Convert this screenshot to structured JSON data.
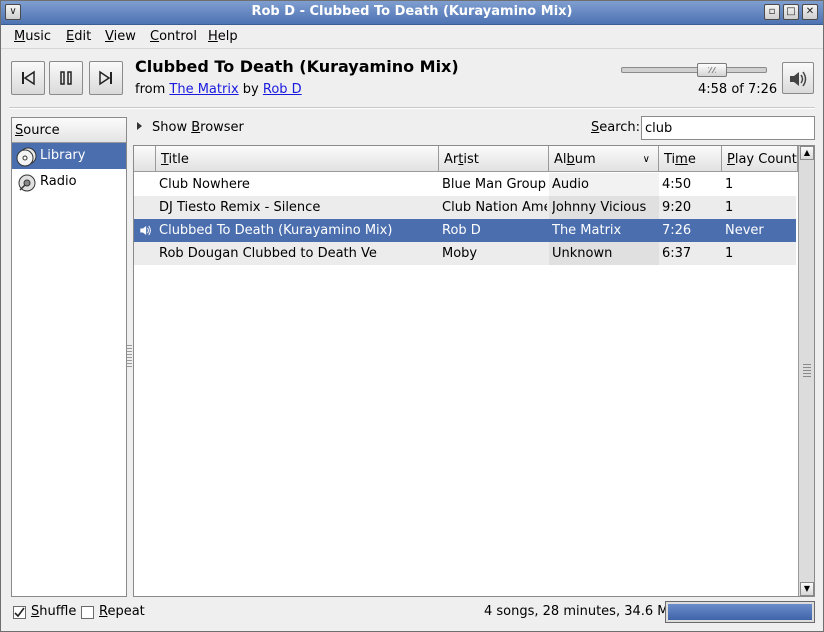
{
  "window": {
    "title": "Rob D - Clubbed To Death (Kurayamino Mix)"
  },
  "menu": [
    {
      "key": "M",
      "rest": "usic"
    },
    {
      "key": "E",
      "rest": "dit"
    },
    {
      "key": "V",
      "rest": "iew"
    },
    {
      "key": "C",
      "rest": "ontrol"
    },
    {
      "key": "H",
      "rest": "elp"
    }
  ],
  "player": {
    "song_title": "Clubbed To Death (Kurayamino Mix)",
    "from_label": "from",
    "album_link": "The Matrix",
    "by_label": "by",
    "artist_link": "Rob D",
    "time_text": "4:58 of 7:26",
    "position_fraction": 0.669,
    "buttons": [
      "previous-icon",
      "pause-icon",
      "next-icon",
      "volume-icon"
    ]
  },
  "sidebar": {
    "header_key": "S",
    "header_rest": "ource",
    "items": [
      {
        "label": "Library",
        "icon": "library-icon",
        "selected": true
      },
      {
        "label": "Radio",
        "icon": "radio-icon",
        "selected": false
      }
    ]
  },
  "browser": {
    "toggle_pre": "Show ",
    "toggle_key": "B",
    "toggle_rest": "rowser"
  },
  "search": {
    "label_key": "S",
    "label_rest": "earch:",
    "value": "club"
  },
  "table": {
    "columns": [
      {
        "key": "T",
        "rest": "itle"
      },
      {
        "pre": "Ar",
        "key": "t",
        "rest": "ist"
      },
      {
        "pre": "Al",
        "key": "b",
        "rest": "um"
      },
      {
        "pre": "Ti",
        "key": "m",
        "rest": "e"
      },
      {
        "key": "P",
        "rest": "lay Count"
      }
    ],
    "sorted_column": "Album",
    "rows": [
      {
        "title": "Club Nowhere",
        "artist": "Blue Man Group",
        "album": "Audio",
        "time": "4:50",
        "plays": "1"
      },
      {
        "title": "DJ Tiesto Remix -  Silence",
        "artist": "Club Nation Amer",
        "album": "Johnny Vicious",
        "time": "9:20",
        "plays": "1"
      },
      {
        "title": "Clubbed To Death (Kurayamino Mix)",
        "artist": "Rob D",
        "album": "The Matrix",
        "time": "7:26",
        "plays": "Never",
        "playing": true
      },
      {
        "title": "Rob Dougan Clubbed to Death Ve",
        "artist": "Moby",
        "album": "Unknown",
        "time": "6:37",
        "plays": "1"
      }
    ]
  },
  "status": {
    "shuffle_key": "S",
    "shuffle_rest": "huffle",
    "shuffle_checked": true,
    "repeat_key": "R",
    "repeat_rest": "epeat",
    "repeat_checked": false,
    "summary": "4 songs, 28 minutes, 34.6 MB",
    "progress_fraction": 1.0
  },
  "colors": {
    "selection": "#4b6eaf",
    "titlebar": "#5f82bd",
    "link": "#1a1adf"
  }
}
